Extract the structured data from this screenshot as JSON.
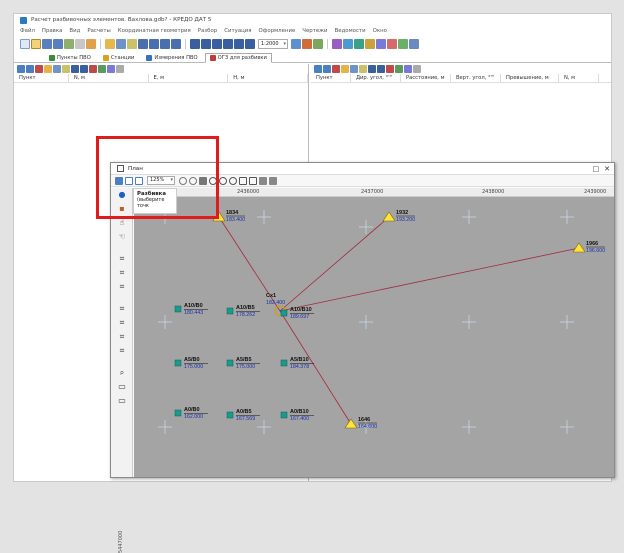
{
  "window": {
    "title": "Расчет разбивочных элементов. Вахлова.gdb? - КРЕДО ДАТ 5"
  },
  "menu": [
    "Файл",
    "Правка",
    "Вид",
    "Расчеты",
    "Координатная геометрия",
    "Разбор",
    "Ситуация",
    "Оформление",
    "Чертежи",
    "Ведомости",
    "Окно"
  ],
  "toolbar": {
    "scale_value": "1:2000"
  },
  "tabs": [
    {
      "label": "Пункты ПВО",
      "icon": "points-icon",
      "color": "#3c8a3c"
    },
    {
      "label": "Станции",
      "icon": "station-icon",
      "color": "#d9a21b"
    },
    {
      "label": "Измерения ПВО",
      "icon": "measure-icon",
      "color": "#3a6fc0"
    },
    {
      "label": "ОГЗ для разбивки",
      "icon": "stakeout-icon",
      "color": "#c23a3a"
    }
  ],
  "left_table": {
    "columns": [
      "Пункт",
      "N, м",
      "E, м",
      "H, м"
    ]
  },
  "right_table": {
    "columns": [
      "Пункт",
      "Дир. угол, °'\"",
      "Расстояние, м",
      "Верт. угол, °'\"",
      "Превышение, м",
      "N, м"
    ]
  },
  "map_window": {
    "title": "План",
    "zoom_value": "125%",
    "win_buttons": {
      "restore": "□",
      "close": "✕"
    },
    "popup": {
      "title": "Разбивка",
      "subtitle": "(выберите точк"
    },
    "x_ticks": [
      "2435000",
      "2436000",
      "2437000",
      "2438000",
      "2439000"
    ],
    "y_tick": "5447000"
  },
  "points": [
    {
      "id": "1834",
      "type": "triangle",
      "name": "1834",
      "elev": "183.400"
    },
    {
      "id": "1932",
      "type": "triangle",
      "name": "1932",
      "elev": "193.200"
    },
    {
      "id": "1966",
      "type": "triangle",
      "name": "1966",
      "elev": "196.600"
    },
    {
      "id": "1646",
      "type": "triangle",
      "name": "1646",
      "elev": "164.600"
    },
    {
      "id": "cx1",
      "type": "station",
      "name": "Сх1",
      "elev": "182.400"
    },
    {
      "id": "a10b0",
      "type": "square",
      "name": "A10/B0",
      "elev": "180.443"
    },
    {
      "id": "a10b5",
      "type": "square",
      "name": "A10/B5",
      "elev": "178.262"
    },
    {
      "id": "a10b10",
      "type": "square",
      "name": "A10/B10",
      "elev": "189.697"
    },
    {
      "id": "a5b0",
      "type": "square",
      "name": "A5/B0",
      "elev": "175.000"
    },
    {
      "id": "a5b5",
      "type": "square",
      "name": "A5/B5",
      "elev": "175.000"
    },
    {
      "id": "a5b10",
      "type": "square",
      "name": "A5/B10",
      "elev": "184.378"
    },
    {
      "id": "a0b0",
      "type": "square",
      "name": "A0/B0",
      "elev": "162.000"
    },
    {
      "id": "a0b5",
      "type": "square",
      "name": "A0/B5",
      "elev": "167.569"
    },
    {
      "id": "a0b10",
      "type": "square",
      "name": "A0/B10",
      "elev": "167.400"
    }
  ],
  "colors": {
    "map_bg": "#a4a4a4",
    "elev_text": "#1a2fb0",
    "line": "#a22a3c",
    "triangle_fill": "#ffe23a",
    "square_fill": "#1a9a8c",
    "highlight": "#e01b1b"
  }
}
